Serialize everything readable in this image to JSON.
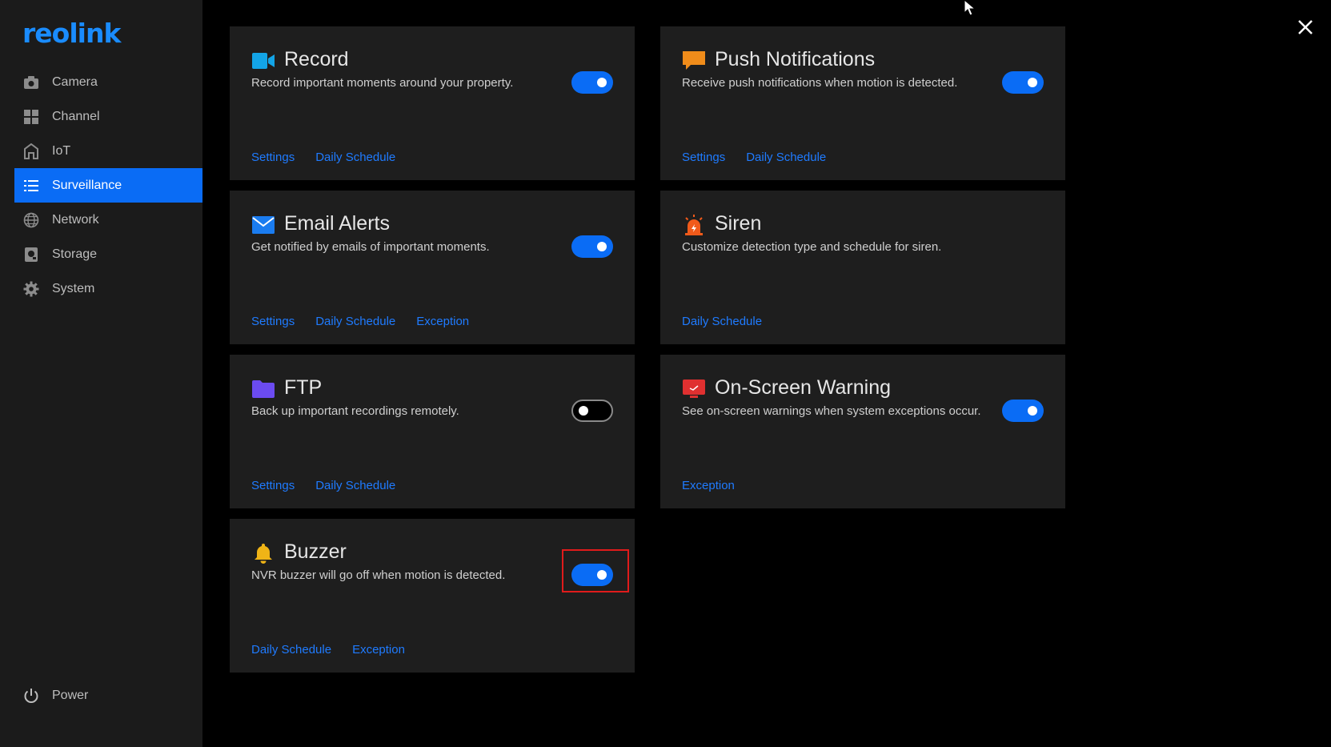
{
  "brand": {
    "logo_text": "reolink",
    "accent": "#0a6cf5",
    "link_color": "#1f7bff"
  },
  "sidebar": {
    "items": [
      {
        "label": "Camera",
        "icon": "camera-icon",
        "active": false
      },
      {
        "label": "Channel",
        "icon": "grid-icon",
        "active": false
      },
      {
        "label": "IoT",
        "icon": "home-icon",
        "active": false
      },
      {
        "label": "Surveillance",
        "icon": "list-icon",
        "active": true
      },
      {
        "label": "Network",
        "icon": "globe-icon",
        "active": false
      },
      {
        "label": "Storage",
        "icon": "storage-icon",
        "active": false
      },
      {
        "label": "System",
        "icon": "gear-icon",
        "active": false
      }
    ],
    "power_label": "Power"
  },
  "cards": {
    "record": {
      "title": "Record",
      "desc": "Record important moments around your property.",
      "enabled": true,
      "links": [
        "Settings",
        "Daily Schedule"
      ]
    },
    "push": {
      "title": "Push Notifications",
      "desc": "Receive push notifications when motion is detected.",
      "enabled": true,
      "links": [
        "Settings",
        "Daily Schedule"
      ]
    },
    "email": {
      "title": "Email Alerts",
      "desc": "Get notified by emails of important moments.",
      "enabled": true,
      "links": [
        "Settings",
        "Daily Schedule",
        "Exception"
      ]
    },
    "siren": {
      "title": "Siren",
      "desc": "Customize detection type and schedule for siren.",
      "links": [
        "Daily Schedule"
      ]
    },
    "ftp": {
      "title": "FTP",
      "desc": "Back up important recordings remotely.",
      "enabled": false,
      "links": [
        "Settings",
        "Daily Schedule"
      ]
    },
    "onscreen": {
      "title": "On-Screen Warning",
      "desc": "See on-screen warnings when system exceptions occur.",
      "enabled": true,
      "links": [
        "Exception"
      ]
    },
    "buzzer": {
      "title": "Buzzer",
      "desc": "NVR buzzer will go off when motion is detected.",
      "enabled": true,
      "links": [
        "Daily Schedule",
        "Exception"
      ]
    }
  }
}
